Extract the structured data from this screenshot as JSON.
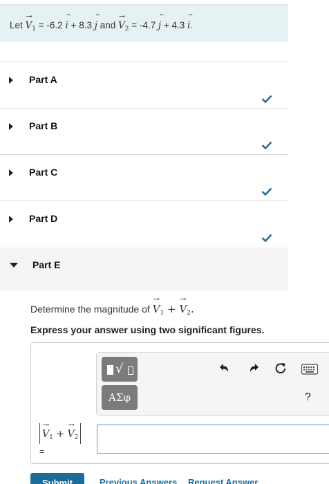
{
  "problem": {
    "let": "Let",
    "v1_symbol": "V",
    "v1_sub": "1",
    "eq1": "= -6.2",
    "i1": "i",
    "plus1": "+ 8.3",
    "j1": "j",
    "and": "and",
    "v2_symbol": "V",
    "v2_sub": "2",
    "eq2": "= -4.7",
    "j2": "j",
    "plus2": "+ 4.3",
    "i2": "i",
    "period": "."
  },
  "parts": [
    {
      "label": "Part A",
      "completed": true
    },
    {
      "label": "Part B",
      "completed": true
    },
    {
      "label": "Part C",
      "completed": true
    },
    {
      "label": "Part D",
      "completed": true
    },
    {
      "label": "Part E",
      "completed": false,
      "expanded": true
    }
  ],
  "colors": {
    "check": "#2a6f8e",
    "primary": "#1c6c99",
    "input_border": "#4b9ec8",
    "toolbar_button": "#7b7b7b",
    "problem_bg": "#e6f1f4"
  },
  "part_e": {
    "question_prefix": "Determine the magnitude of",
    "q_v1": "V",
    "q_v1_sub": "1",
    "q_plus": "+",
    "q_v2": "V",
    "q_v2_sub": "2",
    "q_period": ".",
    "instruction": "Express your answer using two significant figures.",
    "toolbar": {
      "templates_icon": "templates-icon",
      "symbols_label": "ΑΣφ",
      "undo_icon": "undo-icon",
      "redo_icon": "redo-icon",
      "reset_icon": "reset-icon",
      "keyboard_icon": "keyboard-icon",
      "help_label": "?"
    },
    "lhs": {
      "v1": "V",
      "v1_sub": "1",
      "plus": "+",
      "v2": "V",
      "v2_sub": "2",
      "equals": "="
    },
    "answer_value": ""
  },
  "actions": {
    "submit": "Submit",
    "previous_answers": "Previous Answers",
    "request_answer": "Request Answer"
  }
}
